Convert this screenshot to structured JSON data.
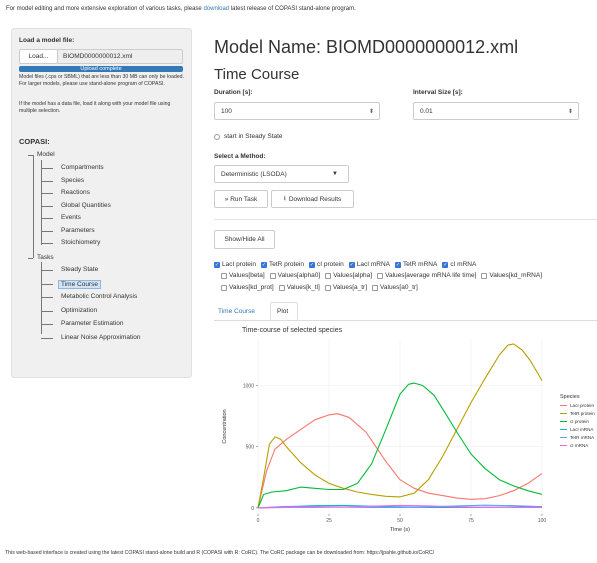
{
  "top_note": {
    "before": "For model editing and more extensive exploration of various tasks, please ",
    "link": "download",
    "after": " latest release of COPASI stand-alone program."
  },
  "sidebar": {
    "load_title": "Load a model file:",
    "load_button": "Load...",
    "file_name": "BIOMD0000000012.xml",
    "progress_text": "Upload complete",
    "progress_fraction": 1.0,
    "note1": "Model files (.cps or SBML) that are less than 30 MB can only be loaded. For larger models, please use stand-alone program of COPASI.",
    "note2": "If the model has a data file, load it along with your model file using multiple selection.",
    "tree_title": "COPASI:",
    "model_label": "Model",
    "model_items": [
      "Compartments",
      "Species",
      "Reactions",
      "Global Quantities",
      "Events",
      "Parameters",
      "Stoichiometry"
    ],
    "tasks_label": "Tasks",
    "task_items": [
      "Steady State",
      "Time Course",
      "Metabolic Control Analysis",
      "Optimization",
      "Parameter Estimation",
      "Linear Noise Approximation"
    ],
    "selected_task": "Time Course"
  },
  "main": {
    "model_title": "Model Name: BIOMD0000000012.xml",
    "task_title": "Time Course",
    "duration_label": "Duration [s]:",
    "duration_value": "100",
    "interval_label": "Interval Size [s]:",
    "interval_value": "0.01",
    "steady_state_label": "start in Steady State",
    "method_label": "Select a Method:",
    "method_value": "Deterministic (LSODA)",
    "run_button": "» Run Task",
    "download_button": "Download Results",
    "showhide_button": "Show/Hide All",
    "checkboxes": [
      {
        "label": "LacI protein",
        "checked": true
      },
      {
        "label": "TetR protein",
        "checked": true
      },
      {
        "label": "cI protein",
        "checked": true
      },
      {
        "label": "LacI mRNA",
        "checked": true
      },
      {
        "label": "TetR mRNA",
        "checked": true
      },
      {
        "label": "cI mRNA",
        "checked": true
      },
      {
        "label": "Values[beta]",
        "checked": false
      },
      {
        "label": "Values[alpha0]",
        "checked": false
      },
      {
        "label": "Values[alpha]",
        "checked": false
      },
      {
        "label": "Values[average mRNA life time]",
        "checked": false
      },
      {
        "label": "Values[kd_mRNA]",
        "checked": false
      },
      {
        "label": "Values[kd_prot]",
        "checked": false
      },
      {
        "label": "Values[k_tl]",
        "checked": false
      },
      {
        "label": "Values[a_tr]",
        "checked": false
      },
      {
        "label": "Values[a0_tr]",
        "checked": false
      }
    ],
    "tabs": [
      "Time Course",
      "Plot"
    ],
    "active_tab": "Plot"
  },
  "chart_data": {
    "type": "line",
    "title": "Time-course of selected species",
    "xlabel": "Time (s)",
    "ylabel": "Concentration",
    "xlim": [
      0,
      100
    ],
    "ylim": [
      -50,
      1380
    ],
    "xticks": [
      0,
      25,
      50,
      75,
      100
    ],
    "yticks": [
      0,
      500,
      1000
    ],
    "legend_title": "Species",
    "legend_position": "right",
    "series": [
      {
        "name": "LacI protein",
        "color": "#f8766d",
        "x": [
          0,
          3,
          6,
          10,
          15,
          20,
          25,
          28,
          32,
          38,
          45,
          50,
          55,
          60,
          65,
          70,
          75,
          80,
          85,
          90,
          95,
          100
        ],
        "y": [
          0,
          300,
          480,
          560,
          640,
          720,
          760,
          770,
          740,
          620,
          380,
          230,
          160,
          120,
          100,
          80,
          70,
          75,
          100,
          140,
          200,
          280
        ]
      },
      {
        "name": "TetR protein",
        "color": "#b79f00",
        "x": [
          0,
          2,
          4,
          6,
          8,
          10,
          15,
          20,
          25,
          30,
          35,
          40,
          45,
          50,
          55,
          60,
          65,
          70,
          75,
          80,
          85,
          88,
          90,
          93,
          96,
          100
        ],
        "y": [
          0,
          250,
          520,
          580,
          560,
          500,
          370,
          270,
          200,
          160,
          130,
          110,
          95,
          90,
          120,
          230,
          420,
          640,
          860,
          1060,
          1250,
          1330,
          1340,
          1290,
          1200,
          1040
        ]
      },
      {
        "name": "cI protein",
        "color": "#00ba38",
        "x": [
          0,
          2,
          5,
          10,
          15,
          20,
          25,
          30,
          35,
          40,
          45,
          50,
          53,
          55,
          58,
          62,
          65,
          70,
          75,
          80,
          85,
          90,
          95,
          100
        ],
        "y": [
          0,
          110,
          130,
          140,
          170,
          160,
          150,
          150,
          200,
          360,
          640,
          930,
          1010,
          1020,
          1000,
          920,
          810,
          620,
          440,
          320,
          230,
          180,
          140,
          110
        ]
      },
      {
        "name": "LacI mRNA",
        "color": "#00bfc4",
        "x": [
          0,
          10,
          20,
          30,
          40,
          50,
          60,
          70,
          80,
          90,
          100
        ],
        "y": [
          0,
          10,
          18,
          20,
          14,
          8,
          4,
          4,
          5,
          7,
          10
        ]
      },
      {
        "name": "TetR mRNA",
        "color": "#619cff",
        "x": [
          0,
          10,
          20,
          30,
          40,
          50,
          60,
          70,
          80,
          90,
          100
        ],
        "y": [
          0,
          12,
          10,
          6,
          4,
          4,
          8,
          16,
          22,
          18,
          10
        ]
      },
      {
        "name": "cI mRNA",
        "color": "#f564e3",
        "x": [
          0,
          10,
          20,
          30,
          40,
          50,
          60,
          70,
          80,
          90,
          100
        ],
        "y": [
          0,
          4,
          4,
          6,
          14,
          20,
          16,
          9,
          5,
          4,
          4
        ]
      }
    ]
  },
  "bottom_note": "This web-based interface is created using the latest COPASI stand-alone build and R (COPASI with R: CoRC). The CoRC package can be downloaded from: https://jpahle.github.io/CoRC/"
}
